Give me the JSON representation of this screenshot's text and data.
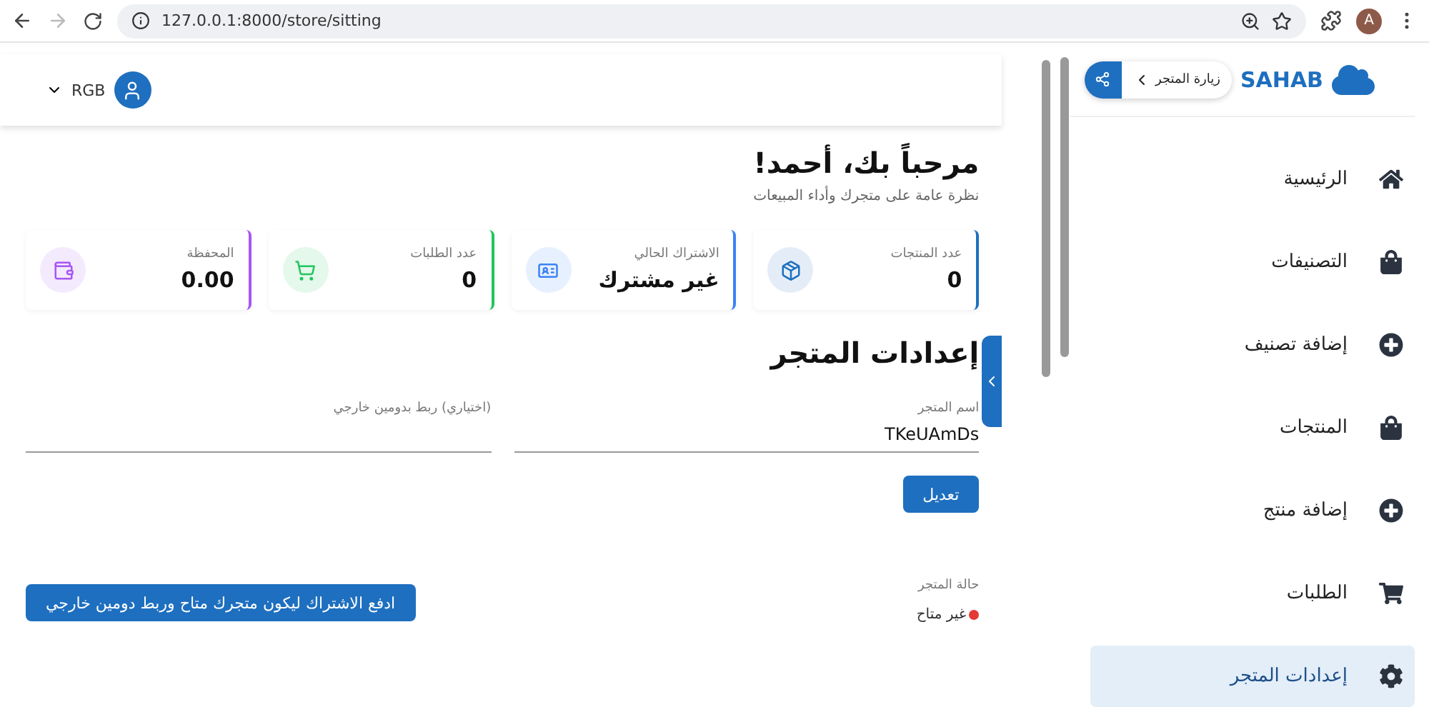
{
  "browser": {
    "url": "127.0.0.1:8000/store/sitting",
    "forward_disabled": true,
    "profile_initial": "A"
  },
  "header": {
    "user": "RGB"
  },
  "welcome": {
    "title": "مرحباً بك، أحمد!",
    "subtitle": "نظرة عامة على متجرك وأداء المبيعات"
  },
  "stats": [
    {
      "label": "عدد المنتجات",
      "value": "0",
      "kind": "box",
      "color": "#1e6fbf"
    },
    {
      "label": "الاشتراك الحالي",
      "value": "غير مشترك",
      "kind": "card",
      "color": "#3b82f6"
    },
    {
      "label": "عدد الطلبات",
      "value": "0",
      "kind": "cart",
      "color": "#22c55e"
    },
    {
      "label": "المحفظة",
      "value": "0.00",
      "kind": "wallet",
      "color": "#a855f7"
    }
  ],
  "settings": {
    "title": "إعدادات المتجر",
    "fields": [
      {
        "label": "اسم المتجر",
        "value": "TKeUAmDs"
      },
      {
        "label": "(اختياري) ربط بدومين خارجي"
      }
    ],
    "edit_button": "تعديل",
    "status_label": "حالة المتجر",
    "status": {
      "text": "غير متاح",
      "color": "#e53935"
    },
    "pay_button": "ادفع الاشتراك ليكون متجرك متاح وربط دومين خارجي"
  },
  "sidebar": {
    "logo": "SAHAB",
    "visit": "زيارة المتجر",
    "items": [
      {
        "label": "الرئيسية",
        "kind": "home",
        "selected": false
      },
      {
        "label": "التصنيفات",
        "kind": "bag",
        "selected": false
      },
      {
        "label": "إضافة تصنيف",
        "kind": "plus",
        "selected": false
      },
      {
        "label": "المنتجات",
        "kind": "bag",
        "selected": false
      },
      {
        "label": "إضافة منتج",
        "kind": "plus",
        "selected": false
      },
      {
        "label": "الطلبات",
        "kind": "cart",
        "selected": false
      },
      {
        "label": "إعدادات المتجر",
        "kind": "gear",
        "selected": true
      }
    ]
  }
}
